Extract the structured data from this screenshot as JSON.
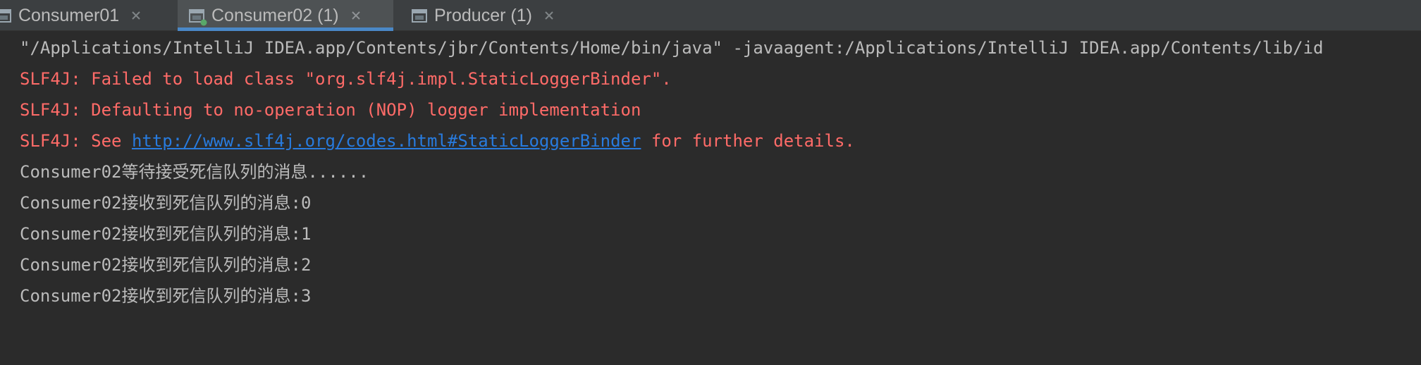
{
  "tabs": [
    {
      "label": "Consumer01",
      "icon": "run-config-icon",
      "active": false,
      "running": false
    },
    {
      "label": "Consumer02 (1)",
      "icon": "run-config-icon",
      "active": true,
      "running": true
    },
    {
      "label": "Producer (1)",
      "icon": "run-config-icon",
      "active": false,
      "running": false
    }
  ],
  "console": {
    "command_line": "\"/Applications/IntelliJ IDEA.app/Contents/jbr/Contents/Home/bin/java\" -javaagent:/Applications/IntelliJ IDEA.app/Contents/lib/id",
    "error_lines": [
      "SLF4J: Failed to load class \"org.slf4j.impl.StaticLoggerBinder\".",
      "SLF4J: Defaulting to no-operation (NOP) logger implementation"
    ],
    "see_line": {
      "prefix": "SLF4J: See ",
      "link": "http://www.slf4j.org/codes.html#StaticLoggerBinder",
      "suffix": " for further details."
    },
    "output_lines": [
      "Consumer02等待接受死信队列的消息......",
      "Consumer02接收到死信队列的消息:0",
      "Consumer02接收到死信队列的消息:1",
      "Consumer02接收到死信队列的消息:2",
      "Consumer02接收到死信队列的消息:3"
    ]
  },
  "colors": {
    "background": "#2b2b2b",
    "tabbar": "#3c3f41",
    "active_tab": "#4e5254",
    "active_underline": "#4a88c7",
    "stdout_text": "#bbbbbb",
    "stderr_text": "#ff6b68",
    "link": "#287bde"
  }
}
